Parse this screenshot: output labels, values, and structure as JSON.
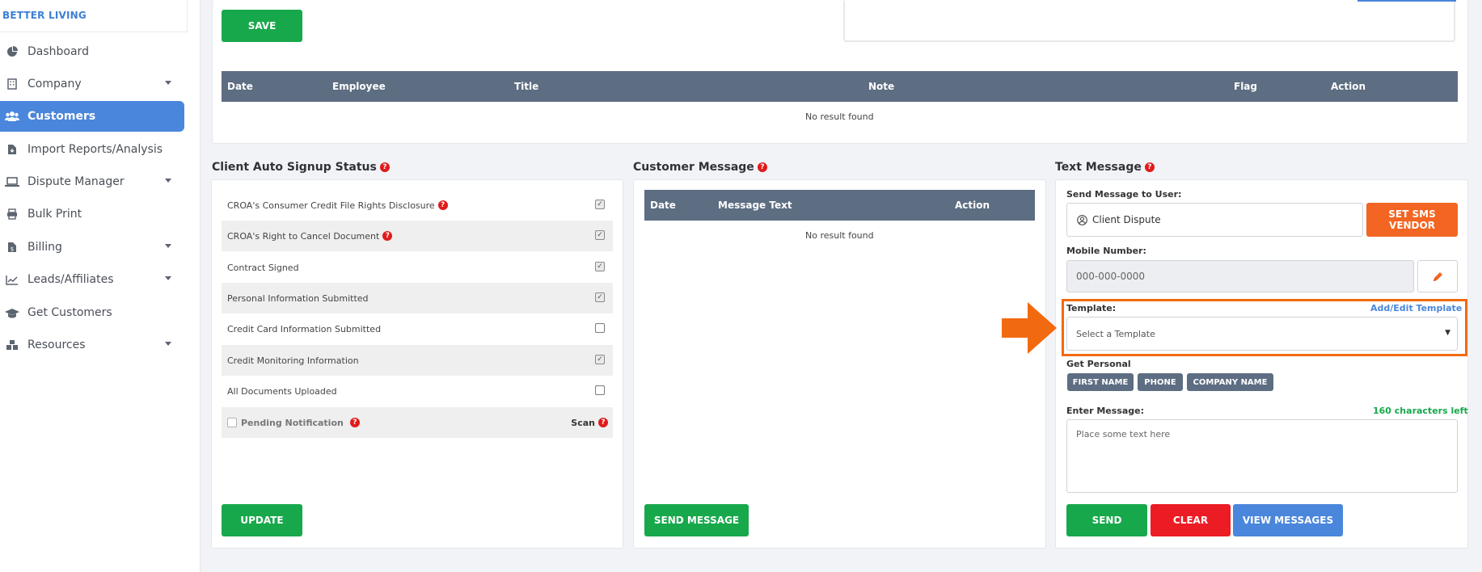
{
  "brand": "BETTER LIVING",
  "sidebar": {
    "items": [
      {
        "label": "Dashboard"
      },
      {
        "label": "Company"
      },
      {
        "label": "Customers"
      },
      {
        "label": "Import Reports/Analysis"
      },
      {
        "label": "Dispute Manager"
      },
      {
        "label": "Bulk Print"
      },
      {
        "label": "Billing"
      },
      {
        "label": "Leads/Affiliates"
      },
      {
        "label": "Get Customers"
      },
      {
        "label": "Resources"
      }
    ]
  },
  "notes": {
    "save_label": "SAVE",
    "columns": [
      "Date",
      "Employee",
      "Title",
      "Note",
      "Flag",
      "Action"
    ],
    "empty": "No result found"
  },
  "signup": {
    "title": "Client Auto Signup Status",
    "rows": [
      {
        "label": "CROA's Consumer Credit File Rights Disclosure",
        "checked": true
      },
      {
        "label": "CROA's Right to Cancel Document",
        "checked": true
      },
      {
        "label": "Contract Signed",
        "checked": true
      },
      {
        "label": "Personal Information Submitted",
        "checked": true
      },
      {
        "label": "Credit Card Information Submitted",
        "checked": false
      },
      {
        "label": "Credit Monitoring Information",
        "checked": true
      },
      {
        "label": "All Documents Uploaded",
        "checked": false
      }
    ],
    "pending_label": "Pending Notification",
    "scan_label": "Scan",
    "update_label": "UPDATE"
  },
  "customer_message": {
    "title": "Customer Message",
    "columns": [
      "Date",
      "Message Text",
      "Action"
    ],
    "empty": "No result found",
    "send_label": "SEND MESSAGE"
  },
  "text_message": {
    "title": "Text Message",
    "send_to_label": "Send Message to User:",
    "user_value": "Client Dispute",
    "set_vendor_label": "SET SMS VENDOR",
    "mobile_label": "Mobile Number:",
    "mobile_placeholder": "000-000-0000",
    "template_label": "Template:",
    "add_edit_label": "Add/Edit Template",
    "template_placeholder": "Select a Template",
    "get_personal_label": "Get Personal",
    "tags": [
      "FIRST NAME",
      "PHONE",
      "COMPANY NAME"
    ],
    "enter_message_label": "Enter Message:",
    "chars_left": "160 characters left",
    "message_placeholder": "Place some text here",
    "send_label": "SEND",
    "clear_label": "CLEAR",
    "view_label": "VIEW MESSAGES"
  },
  "colors": {
    "accent_blue": "#4a86dc",
    "green": "#18a84c",
    "orange": "#f26522",
    "red": "#ec1c24",
    "header_slate": "#5d6d82",
    "highlight": "#f26a10"
  }
}
